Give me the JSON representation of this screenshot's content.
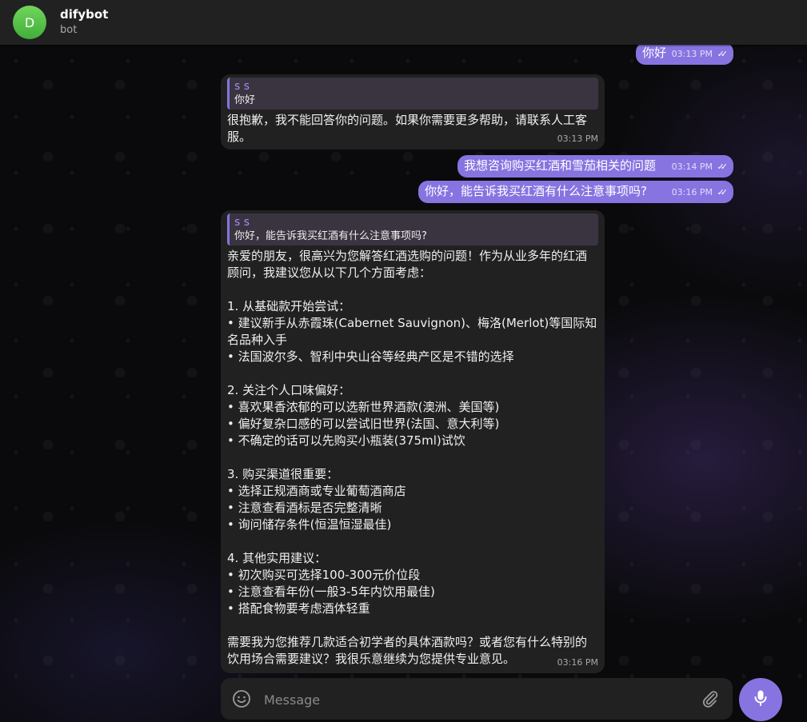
{
  "header": {
    "avatar_letter": "D",
    "name": "difybot",
    "status": "bot"
  },
  "messages": [
    {
      "type": "outgoing",
      "text": "你好",
      "time": "03:13 PM",
      "read": "✓✓"
    },
    {
      "type": "incoming",
      "quote_name": "s s",
      "quote_text": "你好",
      "text": "很抱歉，我不能回答你的问题。如果你需要更多帮助，请联系人工客服。",
      "time": "03:13 PM"
    },
    {
      "type": "outgoing",
      "text": "我想咨询购买红酒和雪茄相关的问题",
      "time": "03:14 PM",
      "read": "✓✓"
    },
    {
      "type": "outgoing",
      "text": "你好，能告诉我买红酒有什么注意事项吗?",
      "time": "03:16 PM",
      "read": "✓✓"
    },
    {
      "type": "incoming",
      "quote_name": "s s",
      "quote_text": "你好，能告诉我买红酒有什么注意事项吗?",
      "lines": [
        "亲爱的朋友，很高兴为您解答红酒选购的问题！作为从业多年的红酒顾问，我建议您从以下几个方面考虑：",
        "",
        "1. 从基础款开始尝试：",
        "• 建议新手从赤霞珠(Cabernet Sauvignon)、梅洛(Merlot)等国际知名品种入手",
        "• 法国波尔多、智利中央山谷等经典产区是不错的选择",
        "",
        "2. 关注个人口味偏好：",
        "• 喜欢果香浓郁的可以选新世界酒款(澳洲、美国等)",
        "• 偏好复杂口感的可以尝试旧世界(法国、意大利等)",
        "• 不确定的话可以先购买小瓶装(375ml)试饮",
        "",
        "3. 购买渠道很重要：",
        "• 选择正规酒商或专业葡萄酒商店",
        "• 注意查看酒标是否完整清晰",
        "• 询问储存条件(恒温恒湿最佳)",
        "",
        "4. 其他实用建议：",
        "• 初次购买可选择100-300元价位段",
        "• 注意查看年份(一般3-5年内饮用最佳)",
        "• 搭配食物要考虑酒体轻重",
        "",
        "需要我为您推荐几款适合初学者的具体酒款吗？或者您有什么特别的饮用场合需要建议？我很乐意继续为您提供专业意见。"
      ],
      "time": "03:16 PM"
    }
  ],
  "composer": {
    "placeholder": "Message"
  },
  "icons": {
    "emoji": "smile-icon",
    "attach": "paperclip-icon",
    "mic": "microphone-icon"
  },
  "colors": {
    "accent": "#8774e1",
    "header_bg": "#212121",
    "incoming_bg": "#212121",
    "avatar": "#5cc24a"
  }
}
